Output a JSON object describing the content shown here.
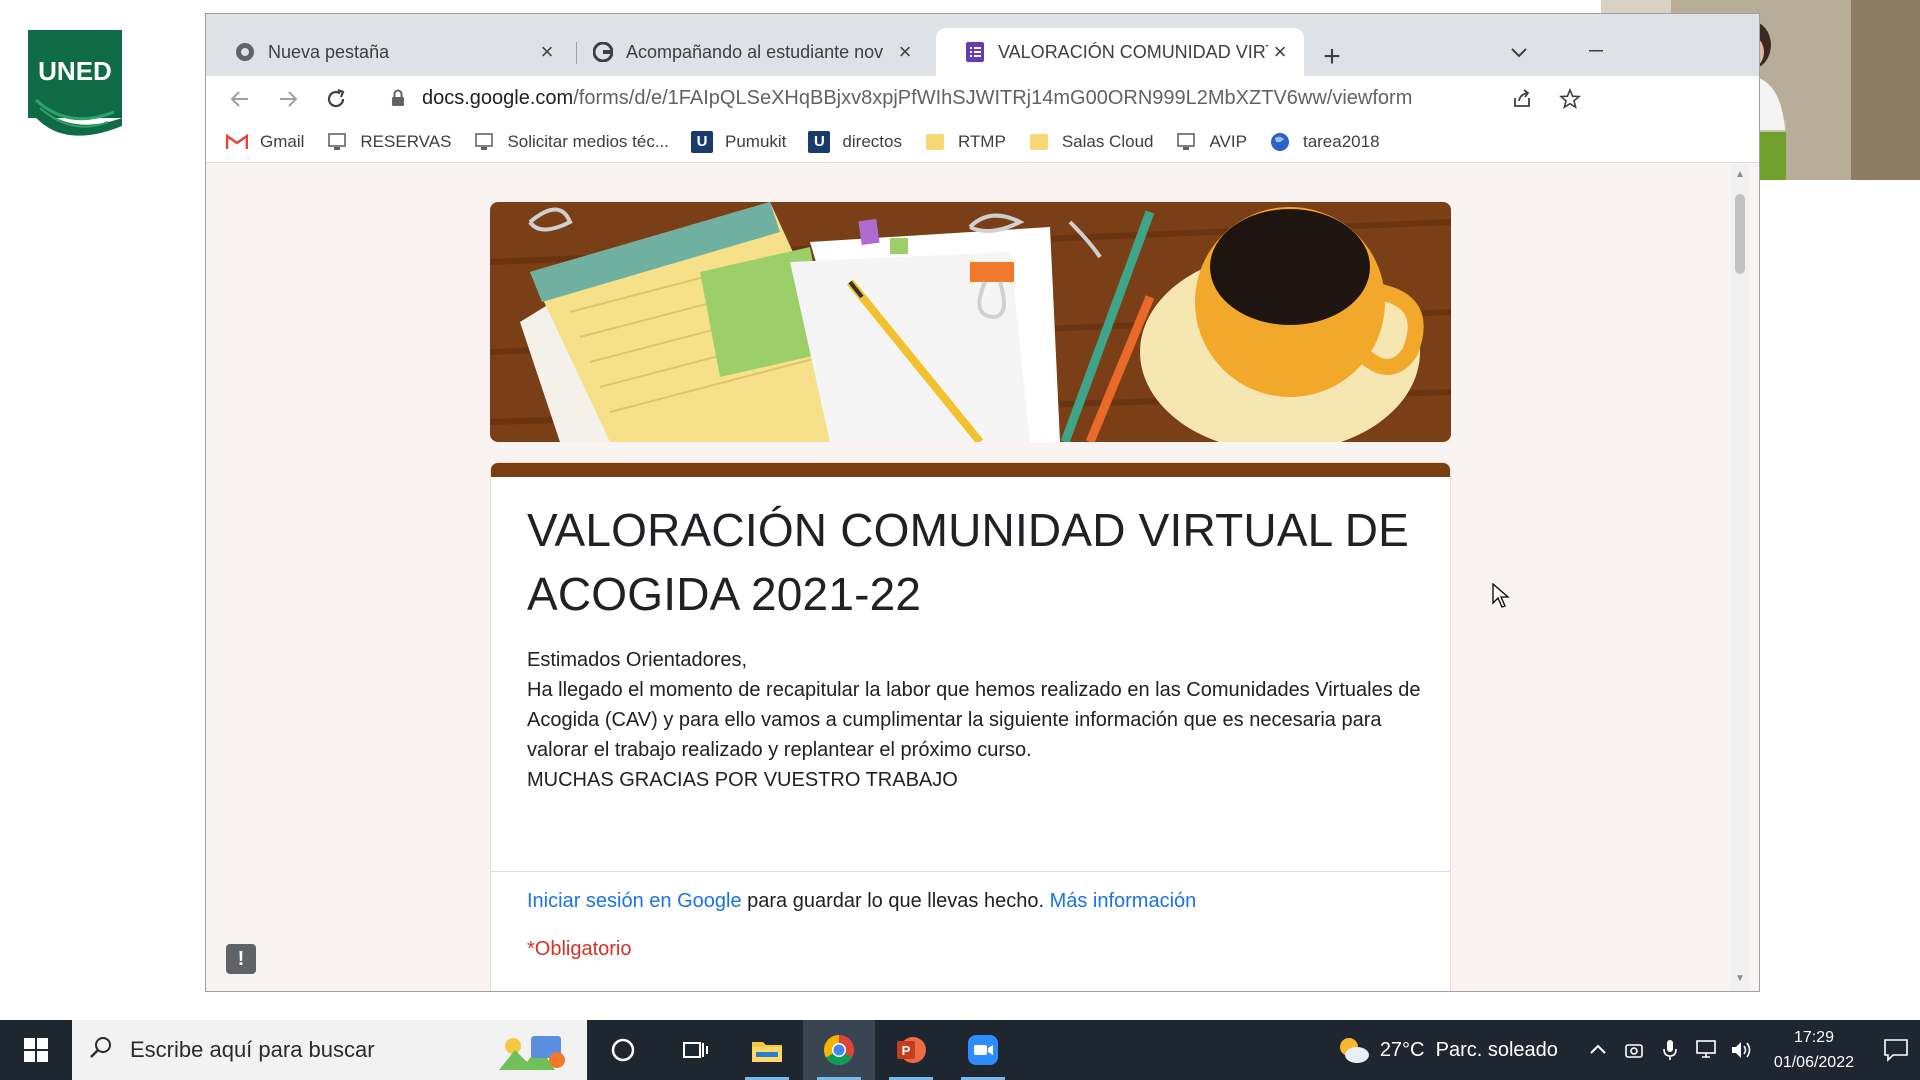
{
  "logo": {
    "text": "UNED"
  },
  "browser": {
    "tabs": [
      {
        "label": "Nueva pestaña",
        "icon": "chrome-icon",
        "active": false
      },
      {
        "label": "Acompañando al estudiante nov",
        "icon": "google-icon",
        "active": false
      },
      {
        "label": "VALORACIÓN COMUNIDAD VIRT",
        "icon": "forms-icon",
        "active": true
      }
    ],
    "new_tab": "+",
    "url_host": "docs.google.com",
    "url_path": "/forms/d/e/1FAIpQLSeXHqBBjxv8xpjPfWIhSJWITRj14mG00ORN999L2MbXZTV6ww/viewform",
    "bookmarks": [
      {
        "label": "Gmail",
        "icon": "gmail-icon"
      },
      {
        "label": "RESERVAS",
        "icon": "monitor-icon"
      },
      {
        "label": "Solicitar medios téc...",
        "icon": "monitor-icon"
      },
      {
        "label": "Pumukit",
        "icon": "u-logo-icon"
      },
      {
        "label": "directos",
        "icon": "u-logo-icon"
      },
      {
        "label": "RTMP",
        "icon": "folder-icon"
      },
      {
        "label": "Salas Cloud",
        "icon": "folder-icon"
      },
      {
        "label": "AVIP",
        "icon": "monitor-icon"
      },
      {
        "label": "tarea2018",
        "icon": "globe-icon"
      }
    ]
  },
  "form": {
    "title": "VALORACIÓN COMUNIDAD VIRTUAL DE ACOGIDA 2021-22",
    "description": [
      "Estimados Orientadores,",
      "Ha llegado el momento de recapitular la labor que hemos realizado en las  Comunidades Virtuales de Acogida (CAV) y para ello vamos a cumplimentar la siguiente información que es necesaria para valorar el trabajo realizado y replantear el próximo curso.",
      "MUCHAS GRACIAS POR VUESTRO TRABAJO"
    ],
    "signin_link": "Iniciar sesión en Google",
    "signin_text": " para guardar lo que llevas hecho. ",
    "more_info_link": "Más información",
    "required_note": "*Obligatorio",
    "theme_color": "#7a3e12"
  },
  "taskbar": {
    "search_placeholder": "Escribe aquí para buscar",
    "weather_temp": "27°C",
    "weather_text": "Parc. soleado",
    "time": "17:29",
    "date": "01/06/2022"
  }
}
